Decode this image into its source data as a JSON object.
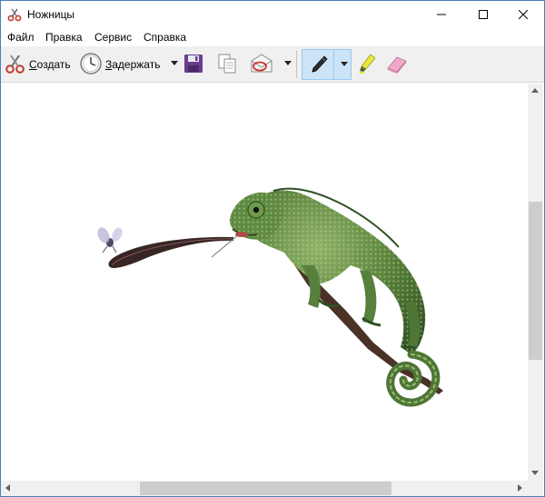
{
  "window": {
    "title": "Ножницы"
  },
  "menu": {
    "items": [
      "Файл",
      "Правка",
      "Сервис",
      "Справка"
    ]
  },
  "toolbar": {
    "new_label_prefix": "С",
    "new_label_rest": "оздать",
    "delay_label_prefix": "З",
    "delay_label_rest": "адержать"
  },
  "icons": {
    "app": "scissors-icon",
    "new": "scissors-icon",
    "delay": "clock-icon",
    "save": "floppy-disk-icon",
    "copy": "copy-icon",
    "send": "envelope-icon",
    "pen": "pen-icon",
    "highlighter": "highlighter-icon",
    "eraser": "eraser-icon"
  },
  "colors": {
    "pen_active_bg": "#cce4f7",
    "chameleon_green": "#4f7f3a",
    "window_border": "#4a7ebb"
  }
}
